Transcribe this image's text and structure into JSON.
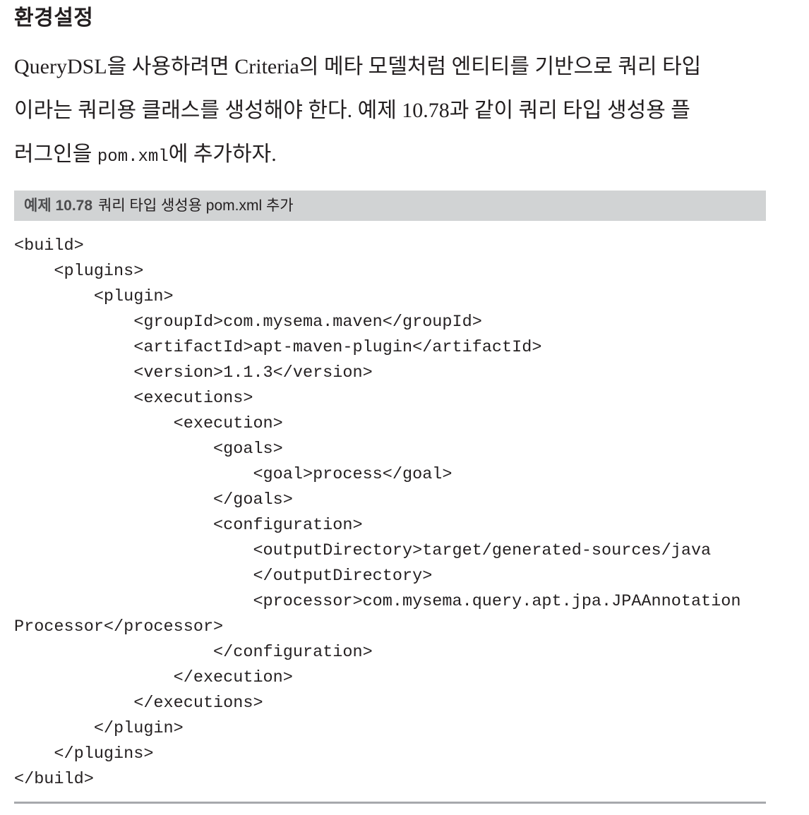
{
  "heading": "환경설정",
  "paragraph": {
    "line1": "QueryDSL을 사용하려면 Criteria의 메타 모델처럼 엔티티를 기반으로 쿼리 타입",
    "line2": "이라는 쿼리용 클래스를 생성해야 한다. 예제 10.78과 같이 쿼리 타입 생성용 플",
    "line3_before": "러그인을 ",
    "line3_code": "pom.xml",
    "line3_after": "에 추가하자."
  },
  "caption": {
    "label": "예제 10.78",
    "title": "쿼리 타입 생성용 pom.xml 추가"
  },
  "code_lines": [
    "<build>",
    "    <plugins>",
    "        <plugin>",
    "            <groupId>com.mysema.maven</groupId>",
    "            <artifactId>apt-maven-plugin</artifactId>",
    "            <version>1.1.3</version>",
    "            <executions>",
    "                <execution>",
    "                    <goals>",
    "                        <goal>process</goal>",
    "                    </goals>",
    "                    <configuration>",
    "                        <outputDirectory>target/generated-sources/java",
    "                        </outputDirectory>",
    "                        <processor>com.mysema.query.apt.jpa.JPAAnnotation",
    "Processor</processor>",
    "                    </configuration>",
    "                </execution>",
    "            </executions>",
    "        </plugin>",
    "    </plugins>",
    "</build>"
  ]
}
